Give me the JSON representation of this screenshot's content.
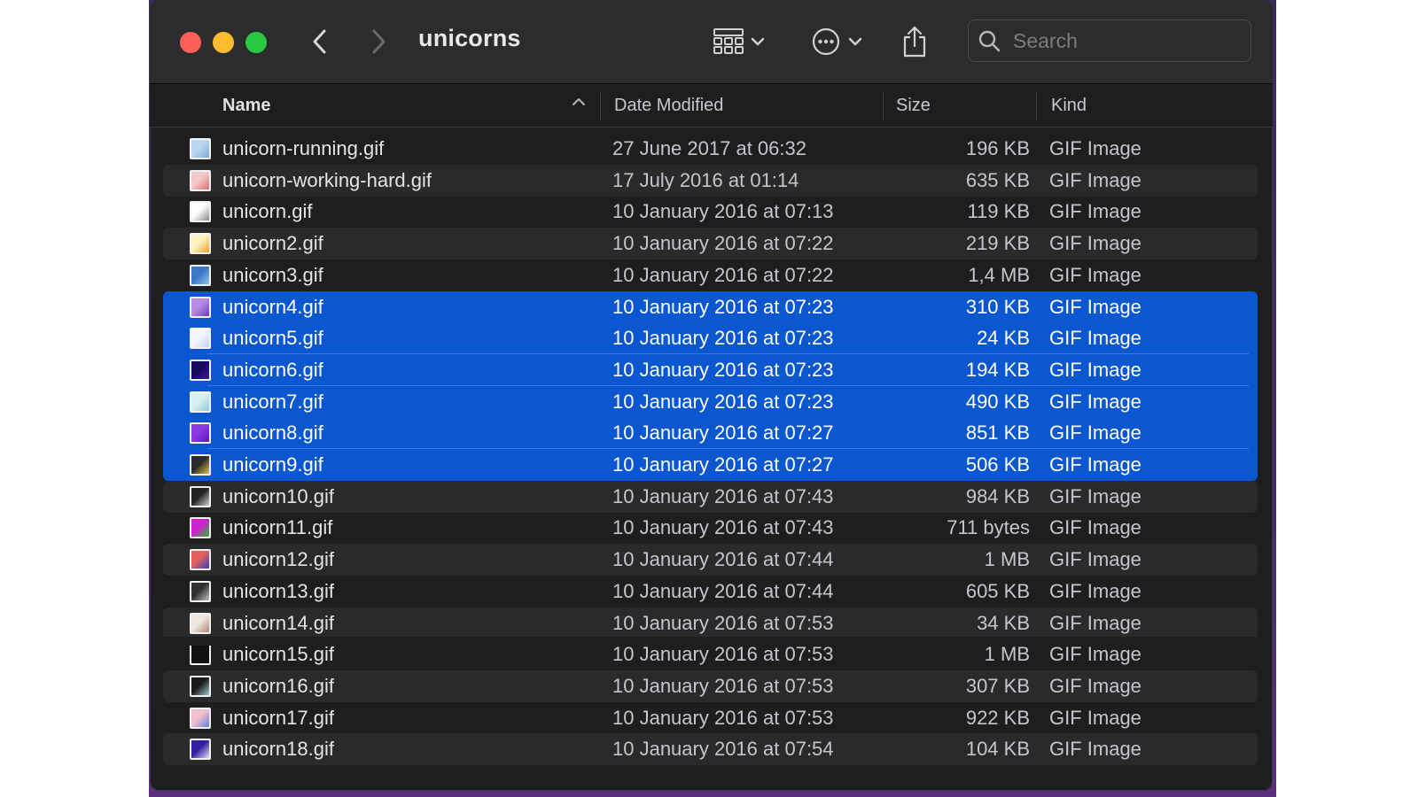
{
  "window": {
    "title": "unicorns"
  },
  "toolbar": {
    "back_icon": "chevron-left-icon",
    "forward_icon": "chevron-right-icon",
    "view_icon": "grid-view-icon",
    "more_icon": "ellipsis-circle-icon",
    "share_icon": "share-icon",
    "search_placeholder": "Search"
  },
  "columns": {
    "name": "Name",
    "date": "Date Modified",
    "size": "Size",
    "kind": "Kind"
  },
  "colors": {
    "selection": "#0a57d0",
    "window_bg": "#1e1e20",
    "alt_row": "#2a2a2c",
    "close": "#fe5f57",
    "minimize": "#febc2e",
    "maximize": "#28c840"
  },
  "files": [
    {
      "name": "unicorn-running.gif",
      "date": "27 June 2017 at 06:32",
      "size": "196 KB",
      "kind": "GIF Image",
      "selected": false,
      "thumb": [
        "#bcd6f0",
        "#7aa8d8"
      ]
    },
    {
      "name": "unicorn-working-hard.gif",
      "date": "17 July 2016 at 01:14",
      "size": "635 KB",
      "kind": "GIF Image",
      "selected": false,
      "thumb": [
        "#f3c9c9",
        "#e07070"
      ]
    },
    {
      "name": "unicorn.gif",
      "date": "10 January 2016 at 07:13",
      "size": "119 KB",
      "kind": "GIF Image",
      "selected": false,
      "thumb": [
        "#ffffff",
        "#888888"
      ]
    },
    {
      "name": "unicorn2.gif",
      "date": "10 January 2016 at 07:22",
      "size": "219 KB",
      "kind": "GIF Image",
      "selected": false,
      "thumb": [
        "#fff3c0",
        "#e9a020"
      ]
    },
    {
      "name": "unicorn3.gif",
      "date": "10 January 2016 at 07:22",
      "size": "1,4 MB",
      "kind": "GIF Image",
      "selected": false,
      "thumb": [
        "#3b78c8",
        "#8fc1f0"
      ]
    },
    {
      "name": "unicorn4.gif",
      "date": "10 January 2016 at 07:23",
      "size": "310 KB",
      "kind": "GIF Image",
      "selected": true,
      "thumb": [
        "#b98ae6",
        "#6a3fb0"
      ]
    },
    {
      "name": "unicorn5.gif",
      "date": "10 January 2016 at 07:23",
      "size": "24 KB",
      "kind": "GIF Image",
      "selected": true,
      "thumb": [
        "#f4f6ff",
        "#c8d0f0"
      ]
    },
    {
      "name": "unicorn6.gif",
      "date": "10 January 2016 at 07:23",
      "size": "194 KB",
      "kind": "GIF Image",
      "selected": true,
      "thumb": [
        "#1a0a5e",
        "#3a1a8e"
      ]
    },
    {
      "name": "unicorn7.gif",
      "date": "10 January 2016 at 07:23",
      "size": "490 KB",
      "kind": "GIF Image",
      "selected": true,
      "thumb": [
        "#d8f0f0",
        "#90c8d8"
      ]
    },
    {
      "name": "unicorn8.gif",
      "date": "10 January 2016 at 07:27",
      "size": "851 KB",
      "kind": "GIF Image",
      "selected": true,
      "thumb": [
        "#8a3ae0",
        "#5a1ab0"
      ]
    },
    {
      "name": "unicorn9.gif",
      "date": "10 January 2016 at 07:27",
      "size": "506 KB",
      "kind": "GIF Image",
      "selected": true,
      "thumb": [
        "#2a2a2a",
        "#e0c040"
      ]
    },
    {
      "name": "unicorn10.gif",
      "date": "10 January 2016 at 07:43",
      "size": "984 KB",
      "kind": "GIF Image",
      "selected": false,
      "thumb": [
        "#222222",
        "#d0d0d0"
      ]
    },
    {
      "name": "unicorn11.gif",
      "date": "10 January 2016 at 07:43",
      "size": "711 bytes",
      "kind": "GIF Image",
      "selected": false,
      "thumb": [
        "#d020d0",
        "#20c020"
      ]
    },
    {
      "name": "unicorn12.gif",
      "date": "10 January 2016 at 07:44",
      "size": "1 MB",
      "kind": "GIF Image",
      "selected": false,
      "thumb": [
        "#e06060",
        "#3040c0"
      ]
    },
    {
      "name": "unicorn13.gif",
      "date": "10 January 2016 at 07:44",
      "size": "605 KB",
      "kind": "GIF Image",
      "selected": false,
      "thumb": [
        "#303030",
        "#c0c0c0"
      ]
    },
    {
      "name": "unicorn14.gif",
      "date": "10 January 2016 at 07:53",
      "size": "34 KB",
      "kind": "GIF Image",
      "selected": false,
      "thumb": [
        "#f0e8e0",
        "#b08878"
      ]
    },
    {
      "name": "unicorn15.gif",
      "date": "10 January 2016 at 07:53",
      "size": "1 MB",
      "kind": "GIF Image",
      "selected": false,
      "thumb": [
        "#111111",
        "#111111"
      ]
    },
    {
      "name": "unicorn16.gif",
      "date": "10 January 2016 at 07:53",
      "size": "307 KB",
      "kind": "GIF Image",
      "selected": false,
      "thumb": [
        "#1a1a1a",
        "#a0c8d0"
      ]
    },
    {
      "name": "unicorn17.gif",
      "date": "10 January 2016 at 07:53",
      "size": "922 KB",
      "kind": "GIF Image",
      "selected": false,
      "thumb": [
        "#f0c0d0",
        "#6080e0"
      ]
    },
    {
      "name": "unicorn18.gif",
      "date": "10 January 2016 at 07:54",
      "size": "104 KB",
      "kind": "GIF Image",
      "selected": false,
      "thumb": [
        "#3020a0",
        "#e0e0f0"
      ]
    }
  ]
}
